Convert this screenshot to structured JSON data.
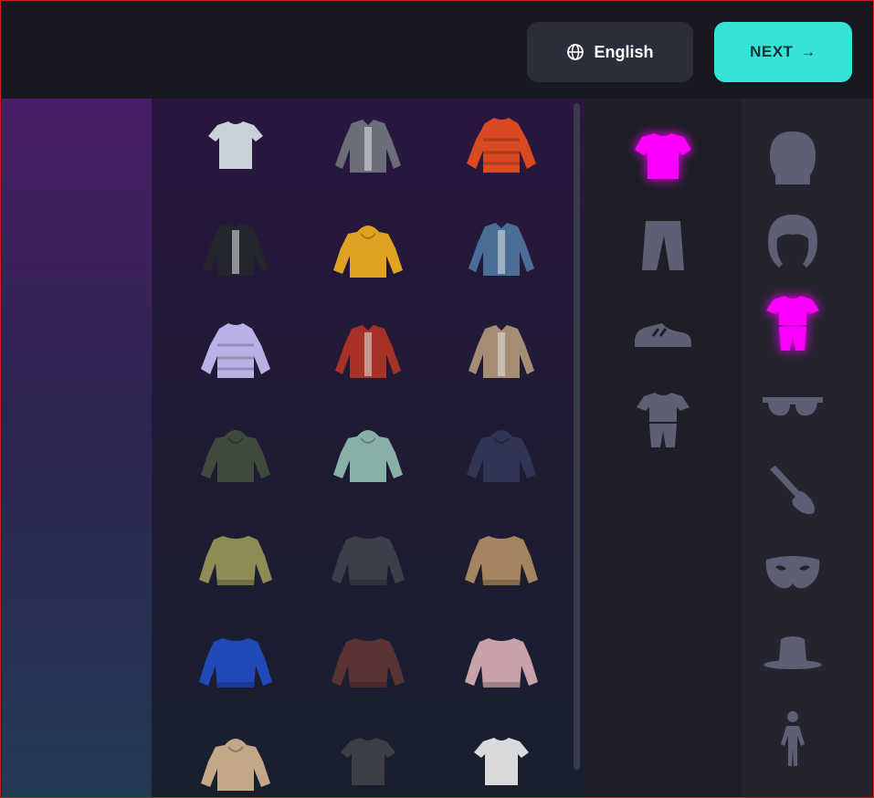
{
  "header": {
    "language_label": "English",
    "next_label": "NEXT",
    "next_arrow": "→"
  },
  "colors": {
    "accent": "#35e4d6",
    "selected": "#ff00ff",
    "icon_inactive": "#5e5f74"
  },
  "clothing_items": [
    {
      "name": "white-tshirt",
      "kind": "tee",
      "color": "#c9d0d8"
    },
    {
      "name": "grey-bomber-jacket",
      "kind": "jacket",
      "color": "#6b6e78"
    },
    {
      "name": "orange-puffer-jacket",
      "kind": "puffer",
      "color": "#d94a22"
    },
    {
      "name": "multicolor-puffer-vest",
      "kind": "jacket",
      "color": "#23262c"
    },
    {
      "name": "yellow-hoodie",
      "kind": "hoodie",
      "color": "#e0a321"
    },
    {
      "name": "denim-jacket",
      "kind": "jacket",
      "color": "#4a6e96"
    },
    {
      "name": "holographic-puffer-jacket",
      "kind": "puffer",
      "color": "#b8b2e6"
    },
    {
      "name": "red-grey-jacket",
      "kind": "jacket",
      "color": "#a53127"
    },
    {
      "name": "beige-open-jacket",
      "kind": "jacket",
      "color": "#a48d74"
    },
    {
      "name": "camo-parka",
      "kind": "hoodie",
      "color": "#3f4a3c"
    },
    {
      "name": "mint-hoodie",
      "kind": "hoodie",
      "color": "#88b0a6"
    },
    {
      "name": "navy-hoodie",
      "kind": "hoodie",
      "color": "#2f3552"
    },
    {
      "name": "camo-sweater",
      "kind": "sweater",
      "color": "#8f8b55"
    },
    {
      "name": "charcoal-sweater",
      "kind": "sweater",
      "color": "#3b3f4a"
    },
    {
      "name": "tan-sweater",
      "kind": "sweater",
      "color": "#a58560"
    },
    {
      "name": "blue-graphic-sweater",
      "kind": "sweater",
      "color": "#2149b8"
    },
    {
      "name": "brown-sweater",
      "kind": "sweater",
      "color": "#5a3234"
    },
    {
      "name": "pastel-block-sweater",
      "kind": "sweater",
      "color": "#c8a2a8"
    },
    {
      "name": "beige-hoodie",
      "kind": "hoodie",
      "color": "#c2a887"
    },
    {
      "name": "dark-tshirt",
      "kind": "tee",
      "color": "#3c3f47"
    },
    {
      "name": "white-graphic-tshirt",
      "kind": "tee",
      "color": "#d8dadc"
    }
  ],
  "clothing_categories": [
    {
      "name": "tops-category",
      "icon": "shirt-icon",
      "selected": true
    },
    {
      "name": "bottoms-category",
      "icon": "pants-icon",
      "selected": false
    },
    {
      "name": "shoes-category",
      "icon": "sneaker-icon",
      "selected": false
    },
    {
      "name": "outfits-category",
      "icon": "outfit-icon",
      "selected": false
    }
  ],
  "main_categories": [
    {
      "name": "head-category",
      "icon": "head-icon",
      "selected": false
    },
    {
      "name": "hair-category",
      "icon": "hair-icon",
      "selected": false
    },
    {
      "name": "outfit-category",
      "icon": "outfit-icon",
      "selected": true
    },
    {
      "name": "glasses-category",
      "icon": "glasses-icon",
      "selected": false
    },
    {
      "name": "makeup-category",
      "icon": "makeup-brush-icon",
      "selected": false
    },
    {
      "name": "mask-category",
      "icon": "mask-icon",
      "selected": false
    },
    {
      "name": "hat-category",
      "icon": "hat-icon",
      "selected": false
    },
    {
      "name": "body-category",
      "icon": "body-icon",
      "selected": false
    }
  ]
}
